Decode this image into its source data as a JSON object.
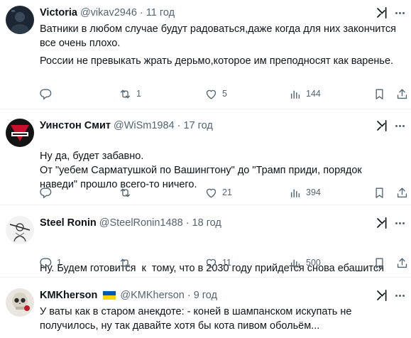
{
  "posts": [
    {
      "name": "Victoria",
      "handle": "@vikav2946",
      "time": "11 год",
      "flag": false,
      "avatar": "dark-profile-photo",
      "paragraphs": [
        "Ватники в любом случае будут радоваться,даже когда для них закончится все очень плохо.",
        "России не превыкать жрать дерьмо,которое им преподносят как варенье."
      ],
      "stats": {
        "replies": "",
        "reposts": "1",
        "likes": "5",
        "views": "144"
      }
    },
    {
      "name": "Уинстон Смит",
      "handle": "@WiSm1984",
      "time": "17 год",
      "flag": false,
      "avatar": "ingsoc-logo",
      "paragraphs": [
        "Ну да, будет забавно.\nОт \"уебем Сарматушкой по Вашингтону\" до \"Трамп приди, порядок наведи\" прошло всего-то ничего."
      ],
      "stats": {
        "replies": "",
        "reposts": "",
        "likes": "21",
        "views": "394"
      }
    },
    {
      "name": "Steel Ronin",
      "handle": "@SteelRonin1488",
      "time": "18 год",
      "flag": false,
      "avatar": "samurai-sketch",
      "paragraphs": [
        "Ну. Будем готовится  к  тому, что в 2030 году прийдется снова ебашится"
      ],
      "stats": {
        "replies": "1",
        "reposts": "",
        "likes": "11",
        "views": "500"
      }
    },
    {
      "name": "KMKherson",
      "handle": "@KMKherson",
      "time": "9 год",
      "flag": true,
      "avatar": "skull-with-rose",
      "paragraphs": [
        "У ваты как в старом анекдоте: - коней в шампанском искупать не получилось, ну так давайте хотя бы кота пивом обольём..."
      ],
      "stats": null
    }
  ],
  "icons": {
    "grok": "grok-icon",
    "more": "more-icon",
    "reply": "reply-icon",
    "repost": "repost-icon",
    "like": "like-icon",
    "views": "views-icon",
    "bookmark": "bookmark-icon",
    "share": "share-icon"
  },
  "colors": {
    "text": "#0f1419",
    "secondary": "#536471",
    "divider": "#eff3f4",
    "flag_blue": "#0057b7",
    "flag_yellow": "#ffd700"
  }
}
